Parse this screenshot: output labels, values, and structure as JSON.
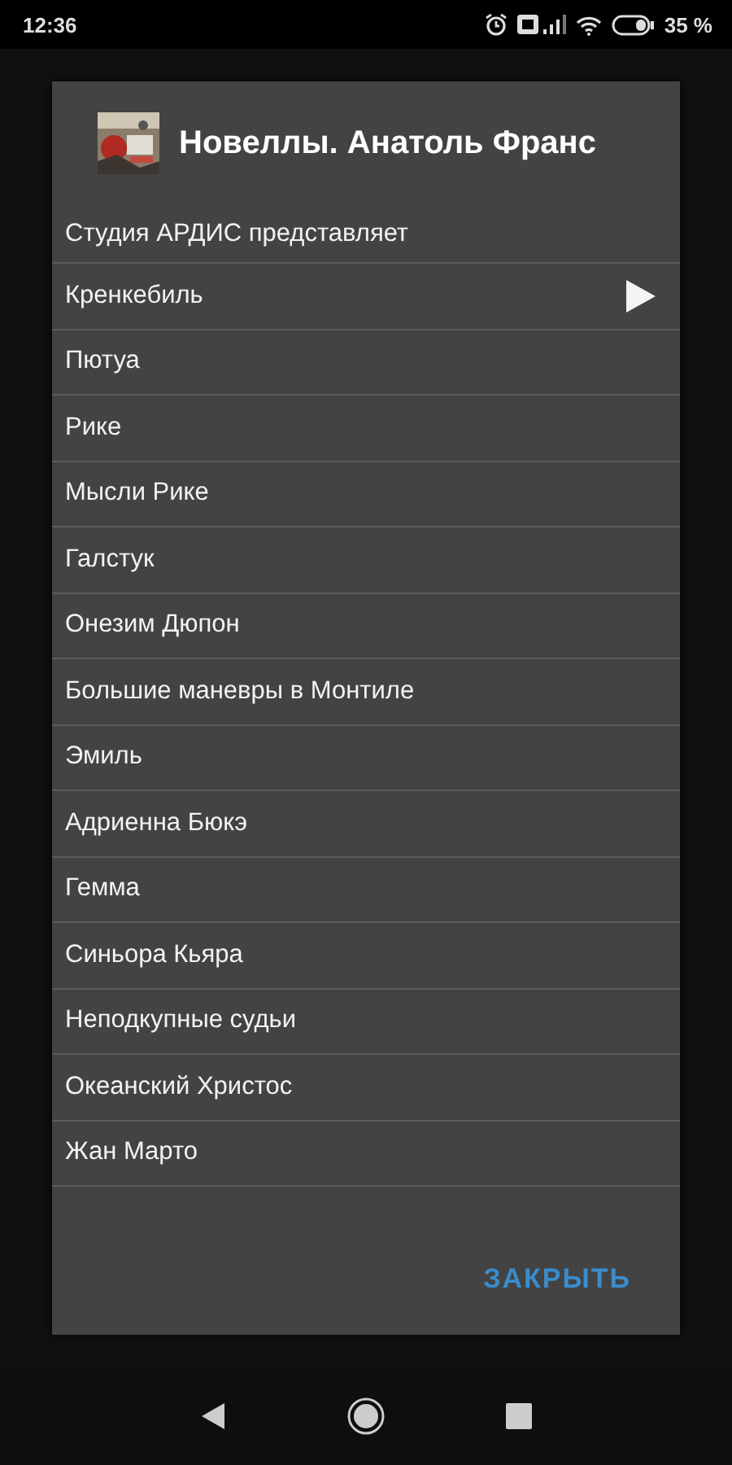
{
  "status_bar": {
    "time": "12:36",
    "battery": "35 %"
  },
  "dialog": {
    "title": "Новеллы. Анатоль Франс",
    "items": [
      {
        "title": "Студия АРДИС представляет",
        "playing": false
      },
      {
        "title": "Кренкебиль",
        "playing": true
      },
      {
        "title": "Пютуа",
        "playing": false
      },
      {
        "title": "Рике",
        "playing": false
      },
      {
        "title": "Мысли Рике",
        "playing": false
      },
      {
        "title": "Галстук",
        "playing": false
      },
      {
        "title": "Онезим Дюпон",
        "playing": false
      },
      {
        "title": "Большие маневры в Монтиле",
        "playing": false
      },
      {
        "title": "Эмиль",
        "playing": false
      },
      {
        "title": "Адриенна Бюкэ",
        "playing": false
      },
      {
        "title": "Гемма",
        "playing": false
      },
      {
        "title": "Синьора Кьяра",
        "playing": false
      },
      {
        "title": "Неподкупные судьи",
        "playing": false
      },
      {
        "title": "Океанский Христос",
        "playing": false
      },
      {
        "title": "Жан Марто",
        "playing": false
      }
    ],
    "close_button": "ЗАКРЫТЬ"
  }
}
